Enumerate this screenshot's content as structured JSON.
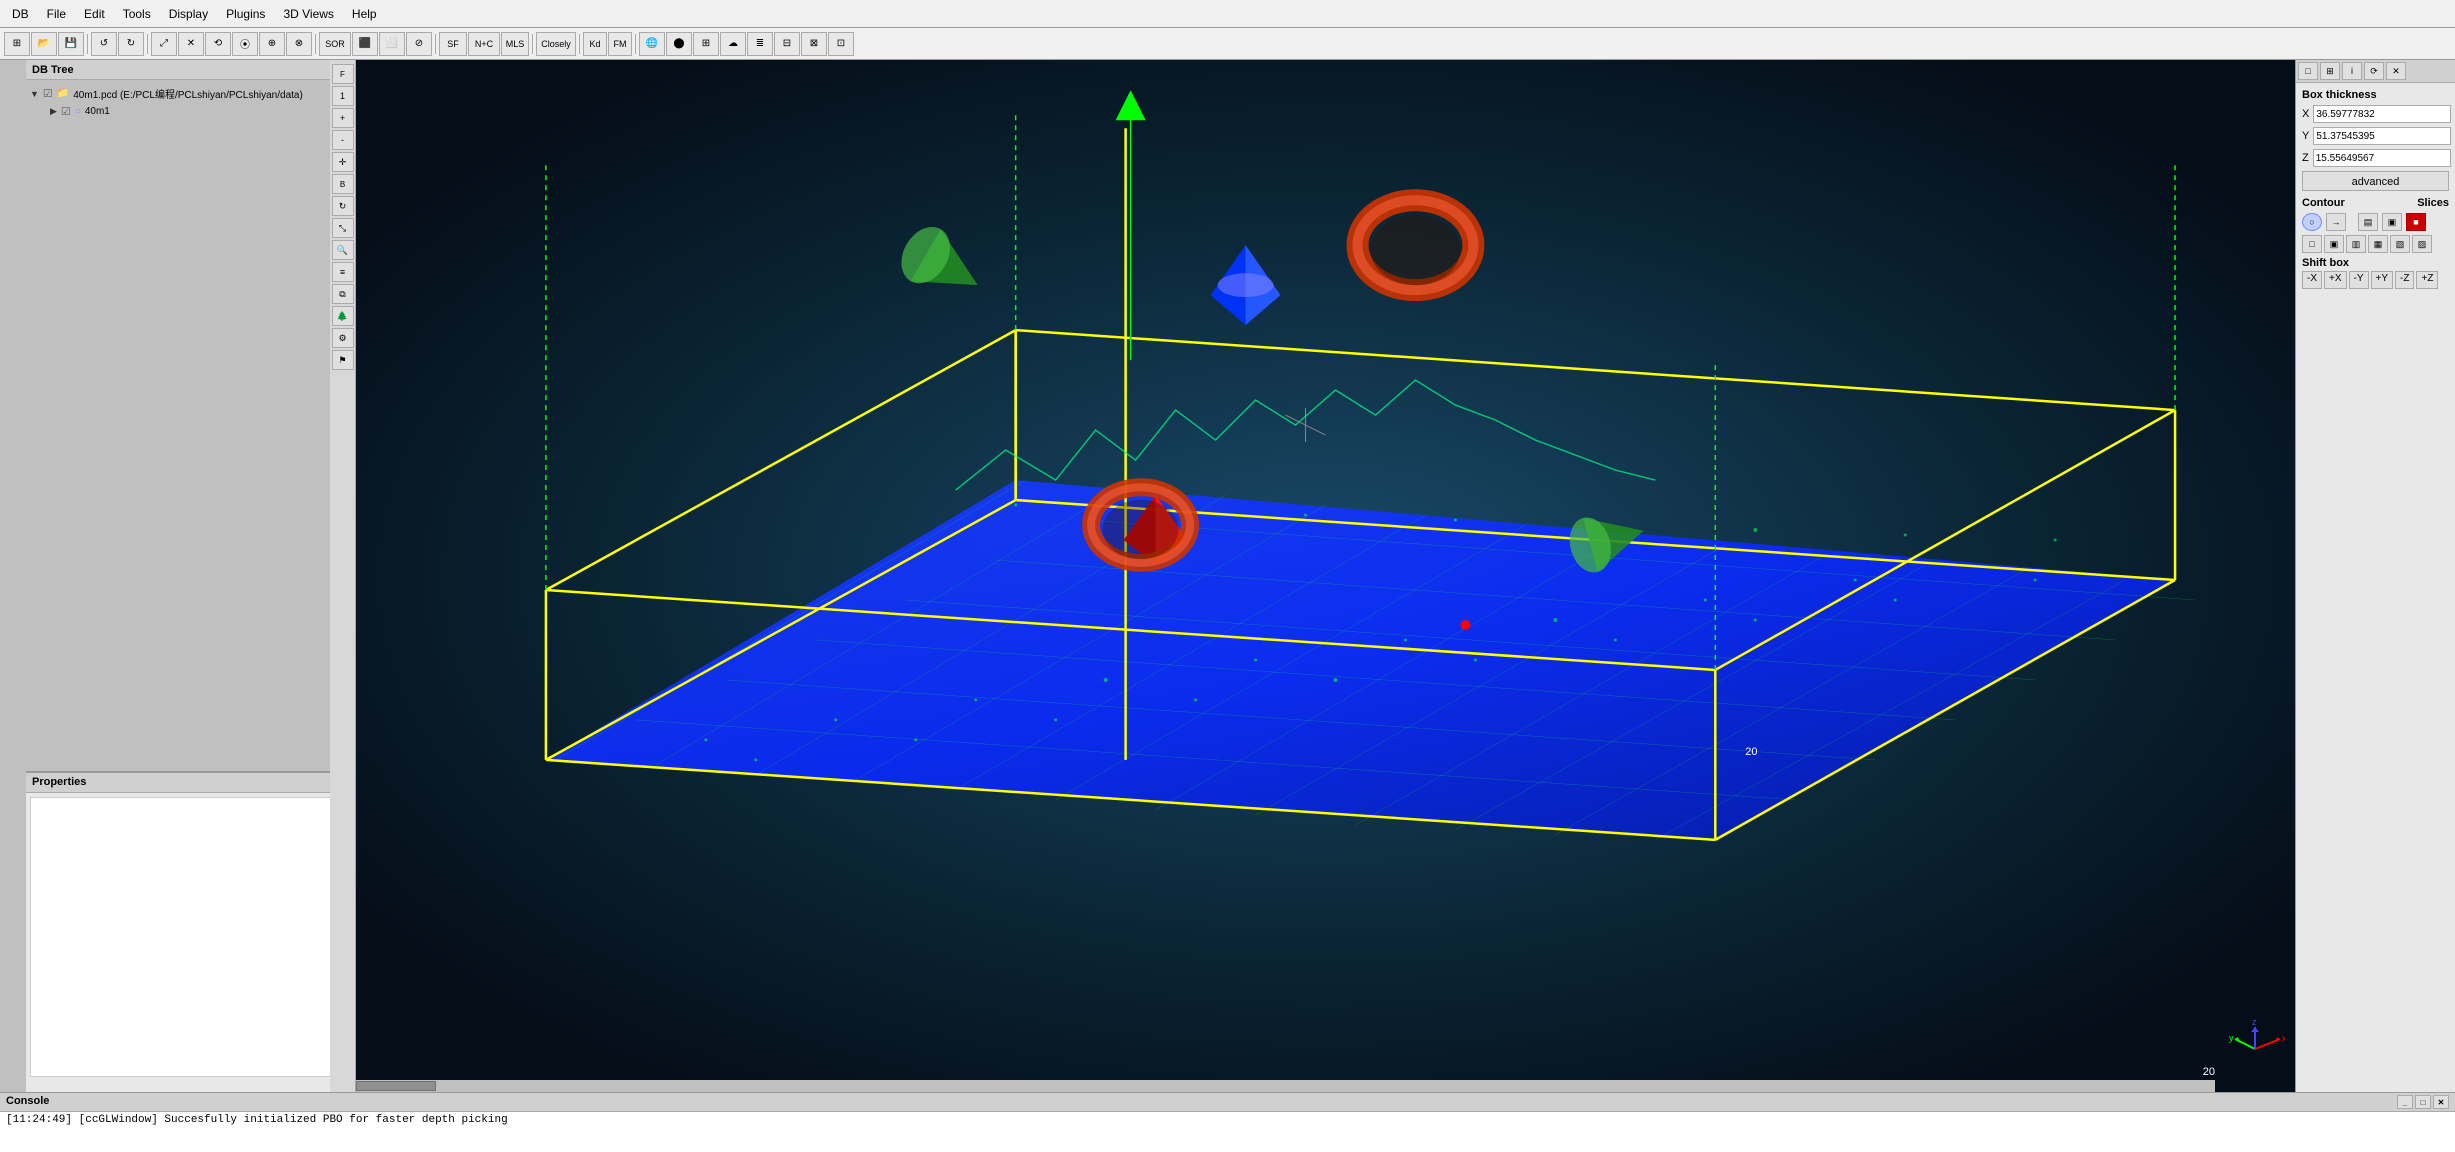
{
  "menu": {
    "items": [
      "DB",
      "File",
      "Edit",
      "Tools",
      "Display",
      "Plugins",
      "3D Views",
      "Help"
    ]
  },
  "toolbar": {
    "groups": [
      {
        "buttons": [
          "⊞",
          "⊟",
          "⊠",
          "⊡"
        ]
      },
      {
        "buttons": [
          "↺",
          "↻",
          "⤢",
          "✕",
          "⟲",
          "⦿",
          "⊕",
          "⊗",
          "⊘"
        ]
      },
      {
        "buttons": [
          "SOR",
          "",
          "",
          ""
        ]
      },
      {
        "buttons": [
          "SF",
          "N+C",
          "MLS"
        ]
      },
      {
        "buttons": [
          "",
          "Closely"
        ]
      },
      {
        "buttons": [
          "Kd",
          "FM"
        ]
      }
    ]
  },
  "db_tree": {
    "title": "DB Tree",
    "items": [
      {
        "label": "40m1.pcd (E:/PCL编程/PCLshiyan/PCLshiyan/data)",
        "expanded": true,
        "icon": "folder"
      },
      {
        "label": "40m1",
        "expanded": false,
        "icon": "point-cloud",
        "indent": 1
      }
    ]
  },
  "properties": {
    "title": "Properties"
  },
  "right_panel": {
    "header_buttons": [
      "□",
      "⊞",
      "i",
      "⟳",
      "✕"
    ],
    "box_thickness": {
      "label": "Box thickness",
      "x_label": "X",
      "x_value": "36.59777832",
      "y_label": "Y",
      "y_value": "51.37545395",
      "z_label": "Z",
      "z_value": "15.55649567"
    },
    "advanced_label": "advanced",
    "contour_label": "Contour",
    "slices_label": "Slices",
    "contour_buttons": [
      "○",
      "→"
    ],
    "slices_buttons": [
      "▤",
      "▣",
      "■"
    ],
    "extra_buttons_row1": [
      "□",
      "▣",
      "▥",
      "▦",
      "▧",
      "▨"
    ],
    "shift_box_label": "Shift box",
    "shift_buttons": [
      "-X",
      "+X",
      "-Y",
      "+Y",
      "-Z",
      "+Z"
    ]
  },
  "console": {
    "title": "Console",
    "message": "[11:24:49] [ccGLWindow] Succesfully initialized PBO for faster depth picking"
  },
  "scene": {
    "box_color": "#ffff00",
    "point_cloud_color": "#1a6fff",
    "background_gradient_start": "#1a4060",
    "background_gradient_end": "#050d18"
  },
  "viewport": {
    "zoom_level": "20",
    "cursor_x": "1436",
    "cursor_y": "684"
  }
}
